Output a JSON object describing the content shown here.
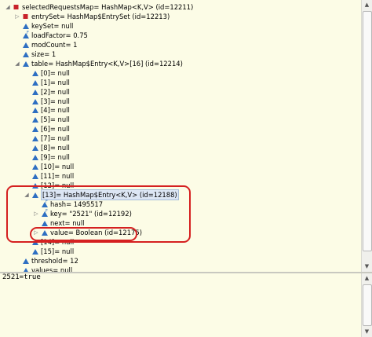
{
  "colors": {
    "background": "#fcfce6",
    "highlight": "#d52020",
    "field_icon": "#2e6fc2",
    "entry_icon": "#c8222a"
  },
  "variables": [
    {
      "depth": 0,
      "twisty": "expanded",
      "icon": "red-square-icon",
      "label": "selectedRequestsMap= HashMap<K,V>  (id=12211)"
    },
    {
      "depth": 1,
      "twisty": "collapsed",
      "icon": "red-square-icon",
      "label": "entrySet= HashMap$EntrySet  (id=12213)"
    },
    {
      "depth": 1,
      "twisty": "none",
      "icon": "blue-triangle-icon",
      "label": "keySet= null"
    },
    {
      "depth": 1,
      "twisty": "none",
      "icon": "blue-triangle-final-icon",
      "label": "loadFactor= 0.75"
    },
    {
      "depth": 1,
      "twisty": "none",
      "icon": "blue-triangle-icon",
      "label": "modCount= 1"
    },
    {
      "depth": 1,
      "twisty": "none",
      "icon": "blue-triangle-icon",
      "label": "size= 1"
    },
    {
      "depth": 1,
      "twisty": "expanded",
      "icon": "blue-triangle-icon",
      "label": "table= HashMap$Entry<K,V>[16]  (id=12214)"
    },
    {
      "depth": 2,
      "twisty": "none",
      "icon": "blue-triangle-icon",
      "label": "[0]= null"
    },
    {
      "depth": 2,
      "twisty": "none",
      "icon": "blue-triangle-icon",
      "label": "[1]= null"
    },
    {
      "depth": 2,
      "twisty": "none",
      "icon": "blue-triangle-icon",
      "label": "[2]= null"
    },
    {
      "depth": 2,
      "twisty": "none",
      "icon": "blue-triangle-icon",
      "label": "[3]= null"
    },
    {
      "depth": 2,
      "twisty": "none",
      "icon": "blue-triangle-icon",
      "label": "[4]= null"
    },
    {
      "depth": 2,
      "twisty": "none",
      "icon": "blue-triangle-icon",
      "label": "[5]= null"
    },
    {
      "depth": 2,
      "twisty": "none",
      "icon": "blue-triangle-icon",
      "label": "[6]= null"
    },
    {
      "depth": 2,
      "twisty": "none",
      "icon": "blue-triangle-icon",
      "label": "[7]= null"
    },
    {
      "depth": 2,
      "twisty": "none",
      "icon": "blue-triangle-icon",
      "label": "[8]= null"
    },
    {
      "depth": 2,
      "twisty": "none",
      "icon": "blue-triangle-icon",
      "label": "[9]= null"
    },
    {
      "depth": 2,
      "twisty": "none",
      "icon": "blue-triangle-icon",
      "label": "[10]= null"
    },
    {
      "depth": 2,
      "twisty": "none",
      "icon": "blue-triangle-icon",
      "label": "[11]= null"
    },
    {
      "depth": 2,
      "twisty": "none",
      "icon": "blue-triangle-icon",
      "label": "[12]= null"
    },
    {
      "depth": 2,
      "twisty": "expanded",
      "icon": "blue-triangle-icon",
      "label": "[13]= HashMap$Entry<K,V>  (id=12188)",
      "selected": true
    },
    {
      "depth": 3,
      "twisty": "none",
      "icon": "blue-triangle-final-icon",
      "label": "hash= 1495517"
    },
    {
      "depth": 3,
      "twisty": "collapsed",
      "icon": "blue-triangle-final-icon",
      "label": "key= \"2521\" (id=12192)"
    },
    {
      "depth": 3,
      "twisty": "none",
      "icon": "blue-triangle-icon",
      "label": "next= null"
    },
    {
      "depth": 3,
      "twisty": "collapsed",
      "icon": "blue-triangle-icon",
      "label": "value= Boolean  (id=12175)"
    },
    {
      "depth": 2,
      "twisty": "none",
      "icon": "blue-triangle-icon",
      "label": "[14]= null"
    },
    {
      "depth": 2,
      "twisty": "none",
      "icon": "blue-triangle-icon",
      "label": "[15]= null"
    },
    {
      "depth": 1,
      "twisty": "none",
      "icon": "blue-triangle-icon",
      "label": "threshold= 12"
    },
    {
      "depth": 1,
      "twisty": "none",
      "icon": "blue-triangle-icon",
      "label": "values= null"
    }
  ],
  "detail_value": "2521=true"
}
